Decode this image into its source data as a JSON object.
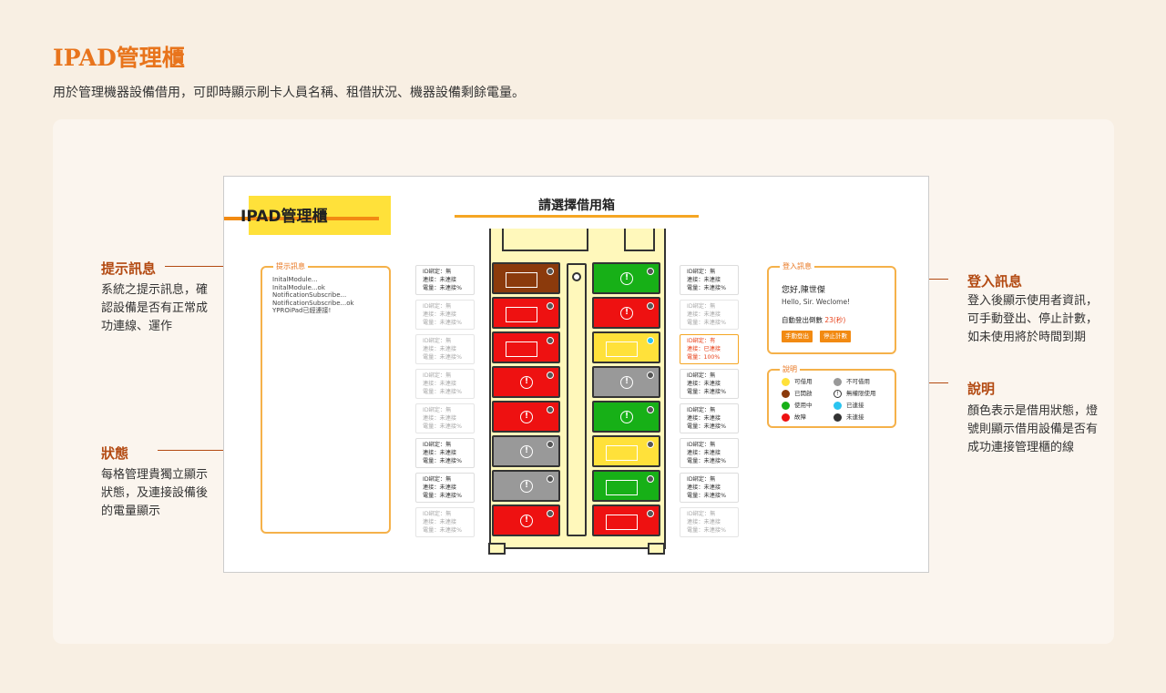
{
  "page": {
    "title": "IPAD管理櫃",
    "subtitle": "用於管理機器設備借用，可即時顯示刷卡人員名稱、租借狀況、機器設備剩餘電量。"
  },
  "annotations": {
    "left": [
      {
        "title": "提示訊息",
        "body": "系統之提示訊息，確認設備是否有正常成功連線、運作"
      },
      {
        "title": "狀態",
        "body": "每格管理貴獨立顯示狀態，及連接設備後的電量顯示"
      }
    ],
    "right": [
      {
        "title": "登入訊息",
        "body": "登入後顯示使用者資訊，可手動登出、停止計數，如未使用將於時間到期"
      },
      {
        "title": "說明",
        "body": "顏色表示是借用狀態，燈號則顯示借用設備是否有成功連接管理櫃的線"
      }
    ]
  },
  "mockup": {
    "logo": "IPAD管理櫃",
    "choose_title": "請選擇借用箱",
    "log_panel": {
      "legend": "提示訊息",
      "lines": [
        "InitalModule...",
        "InitalModule...ok",
        "NotificationSubscribe...",
        "NotificationSubscribe...ok",
        "YPROiPad已經連接!"
      ]
    },
    "left_info": [
      {
        "l1": "ID綁定：無",
        "l2": "連接：未連接",
        "l3": "電量：未連接%",
        "state": "normal"
      },
      {
        "l1": "ID綁定：無",
        "l2": "連接：未連接",
        "l3": "電量：未連接%",
        "state": "faded"
      },
      {
        "l1": "ID綁定：無",
        "l2": "連接：未連接",
        "l3": "電量：未連接%",
        "state": "faded"
      },
      {
        "l1": "ID綁定：無",
        "l2": "連接：未連接",
        "l3": "電量：未連接%",
        "state": "faded"
      },
      {
        "l1": "ID綁定：無",
        "l2": "連接：未連接",
        "l3": "電量：未連接%",
        "state": "faded"
      },
      {
        "l1": "ID綁定：無",
        "l2": "連接：未連接",
        "l3": "電量：未連接%",
        "state": "normal"
      },
      {
        "l1": "ID綁定：無",
        "l2": "連接：未連接",
        "l3": "電量：未連接%",
        "state": "normal"
      },
      {
        "l1": "ID綁定：無",
        "l2": "連接：未連接",
        "l3": "電量：未連接%",
        "state": "faded"
      }
    ],
    "right_info": [
      {
        "l1": "ID綁定：無",
        "l2": "連接：未連接",
        "l3": "電量：未連接%",
        "state": "normal"
      },
      {
        "l1": "ID綁定：無",
        "l2": "連接：未連接",
        "l3": "電量：未連接%",
        "state": "faded"
      },
      {
        "l1": "ID綁定：有",
        "l2": "連接：已連接",
        "l3": "電量：100%",
        "state": "active"
      },
      {
        "l1": "ID綁定：無",
        "l2": "連接：未連接",
        "l3": "電量：未連接%",
        "state": "normal"
      },
      {
        "l1": "ID綁定：無",
        "l2": "連接：未連接",
        "l3": "電量：未連接%",
        "state": "normal"
      },
      {
        "l1": "ID綁定：無",
        "l2": "連接：未連接",
        "l3": "電量：未連接%",
        "state": "normal"
      },
      {
        "l1": "ID綁定：無",
        "l2": "連接：未連接",
        "l3": "電量：未連接%",
        "state": "normal"
      },
      {
        "l1": "ID綁定：無",
        "l2": "連接：未連接",
        "l3": "電量：未連接%",
        "state": "faded"
      }
    ],
    "slots_left": [
      {
        "color": "#8b3a0c",
        "mark": "window",
        "led": "gray"
      },
      {
        "color": "#ee1111",
        "mark": "window",
        "led": "gray"
      },
      {
        "color": "#ee1111",
        "mark": "window",
        "led": "gray"
      },
      {
        "color": "#ee1111",
        "mark": "warn",
        "led": "gray"
      },
      {
        "color": "#ee1111",
        "mark": "warn",
        "led": "gray"
      },
      {
        "color": "#999999",
        "mark": "warn",
        "led": "gray"
      },
      {
        "color": "#999999",
        "mark": "warn",
        "led": "gray"
      },
      {
        "color": "#ee1111",
        "mark": "warn",
        "led": "gray"
      }
    ],
    "slots_right": [
      {
        "color": "#17b017",
        "mark": "warn",
        "led": "gray"
      },
      {
        "color": "#ee1111",
        "mark": "warn",
        "led": "gray"
      },
      {
        "color": "#ffe13a",
        "mark": "window",
        "led": "blue"
      },
      {
        "color": "#999999",
        "mark": "warn",
        "led": "gray"
      },
      {
        "color": "#17b017",
        "mark": "warn",
        "led": "gray"
      },
      {
        "color": "#ffe13a",
        "mark": "window",
        "led": "gray"
      },
      {
        "color": "#17b017",
        "mark": "window",
        "led": "gray"
      },
      {
        "color": "#ee1111",
        "mark": "window",
        "led": "gray"
      }
    ],
    "warn_glyph": "!",
    "login": {
      "legend": "登入訊息",
      "name": "您好,陳世傑",
      "hello": "Hello, Sir. Weclome!",
      "countdown_label": "自動登出倒數",
      "countdown_value": "23(秒)",
      "logout_btn": "手動登出",
      "stop_btn": "停止計數"
    },
    "legend_panel": {
      "legend": "說明",
      "items": [
        {
          "label": "可借用",
          "color": "#ffe13a"
        },
        {
          "label": "不可借用",
          "color": "#999999"
        },
        {
          "label": "已開啟",
          "color": "#8b3a0c"
        },
        {
          "label": "無權限使用",
          "color": "ring"
        },
        {
          "label": "使用中",
          "color": "#17b017"
        },
        {
          "label": "已連接",
          "color": "#2ac4f0"
        },
        {
          "label": "故障",
          "color": "#ee1111"
        },
        {
          "label": "未連接",
          "color": "#333333"
        }
      ]
    }
  }
}
